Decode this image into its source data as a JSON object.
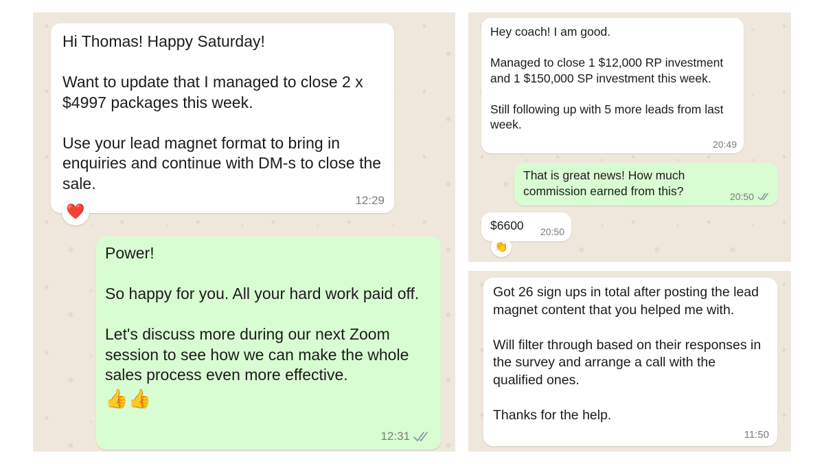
{
  "left_chat": {
    "msg1": {
      "text": "Hi Thomas! Happy Saturday!\n\nWant to update that I managed to close 2 x $4997 packages this week.\n\nUse your lead magnet format to bring in enquiries and continue with DM-s to close the sale.",
      "time": "12:29",
      "reaction": "❤️"
    },
    "msg2": {
      "text": "Power!\n\nSo happy for you. All your hard work paid off.\n\nLet's discuss more during our next Zoom session to see how we can make the whole sales process even more effective.",
      "emoji": "👍👍",
      "time": "12:31"
    }
  },
  "top_right_chat": {
    "msg1": {
      "text": "Hey coach! I am good.\n\nManaged to close 1 $12,000 RP investment and 1 $150,000 SP investment this week.\n\nStill following up with 5 more leads from last week.",
      "time": "20:49"
    },
    "msg2": {
      "text": "That is great news! How much commission earned from this?",
      "time": "20:50"
    },
    "msg3": {
      "text": "$6600",
      "time": "20:50",
      "reaction": "👏"
    }
  },
  "bottom_right_chat": {
    "msg1": {
      "text": "Got 26 sign ups in total after posting the lead magnet content that you helped me with.\n\nWill filter through based on their responses in the survey and arrange a call with the qualified ones.\n\nThanks for the help.",
      "time": "11:50"
    }
  },
  "colors": {
    "incoming_bubble": "#ffffff",
    "outgoing_bubble": "#d9fdd3",
    "wallpaper": "#efe7dc",
    "read_ticks": "#8696a0"
  }
}
